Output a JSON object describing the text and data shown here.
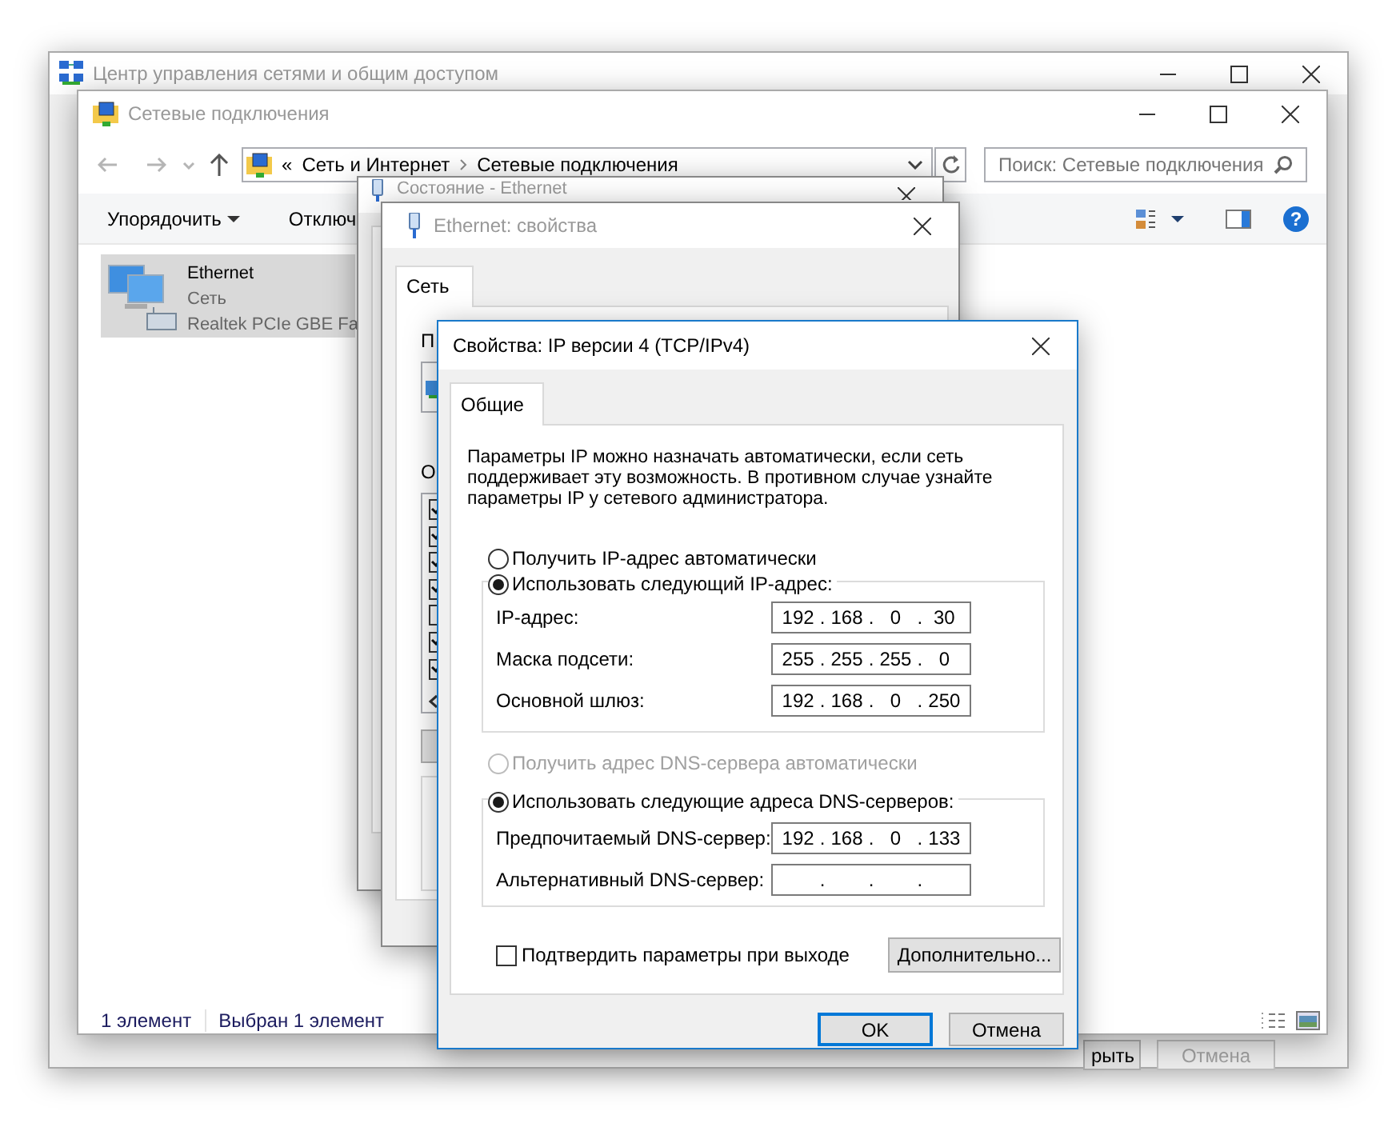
{
  "network_center": {
    "title": "Центр управления сетями и общим доступом",
    "buttons": [
      {
        "label": "рыть",
        "disabled": false
      },
      {
        "label": "Отмена",
        "disabled": true
      }
    ]
  },
  "connections": {
    "title": "Сетевые подключения",
    "address": {
      "overflow": "«",
      "crumbs": [
        "Сеть и Интернет",
        "Сетевые подключения"
      ]
    },
    "search": {
      "placeholder": "Поиск: Сетевые подключения"
    },
    "toolbar": [
      {
        "label": "Упорядочить",
        "menu": true
      },
      {
        "label": "Отключ",
        "menu": false
      }
    ],
    "help": "?",
    "items": [
      {
        "name": "Ethernet",
        "network": "Сеть",
        "adapter": "Realtek PCIe GBE Fa",
        "selected": true
      }
    ],
    "status_bar": [
      "1 элемент",
      "Выбран 1 элемент"
    ]
  },
  "status_window": {
    "title": "Состояние - Ethernet"
  },
  "ethernet_properties": {
    "title": "Ethernet: свойства",
    "tabs": [
      {
        "label": "Сеть",
        "selected": true
      }
    ],
    "connect_label": "П",
    "components_label": "О",
    "components": [
      {
        "checked": true
      },
      {
        "checked": true
      },
      {
        "checked": true
      },
      {
        "checked": true
      },
      {
        "checked": false
      },
      {
        "checked": true
      },
      {
        "checked": true
      }
    ]
  },
  "ipv4": {
    "title": "Свойства: IP версии 4 (TCP/IPv4)",
    "tabs": [
      {
        "label": "Общие",
        "selected": true
      }
    ],
    "description": "Параметры IP можно назначать автоматически, если сеть поддерживает эту возможность. В противном случае узнайте параметры IP у сетевого администратора.",
    "separator": ".",
    "sections": [
      {
        "options": [
          {
            "label": "Получить IP-адрес автоматически",
            "selected": false,
            "disabled": false
          },
          {
            "label": "Использовать следующий IP-адрес:",
            "selected": true,
            "disabled": false
          }
        ],
        "fields": [
          {
            "label": "IP-адрес:",
            "octets": [
              "192",
              "168",
              "0",
              "30"
            ]
          },
          {
            "label": "Маска подсети:",
            "octets": [
              "255",
              "255",
              "255",
              "0"
            ]
          },
          {
            "label": "Основной шлюз:",
            "octets": [
              "192",
              "168",
              "0",
              "250"
            ]
          }
        ]
      },
      {
        "options": [
          {
            "label": "Получить адрес DNS-сервера автоматически",
            "selected": false,
            "disabled": true
          },
          {
            "label": "Использовать следующие адреса DNS-серверов:",
            "selected": true,
            "disabled": false
          }
        ],
        "fields": [
          {
            "label": "Предпочитаемый DNS-сервер:",
            "octets": [
              "192",
              "168",
              "0",
              "133"
            ]
          },
          {
            "label": "Альтернативный DNS-сервер:"
          }
        ]
      }
    ],
    "validate": {
      "label": "Подтвердить параметры при выходе",
      "checked": false
    },
    "advanced_button": "Дополнительно...",
    "buttons": [
      {
        "label": "OK",
        "default": true
      },
      {
        "label": "Отмена",
        "default": false
      }
    ]
  }
}
